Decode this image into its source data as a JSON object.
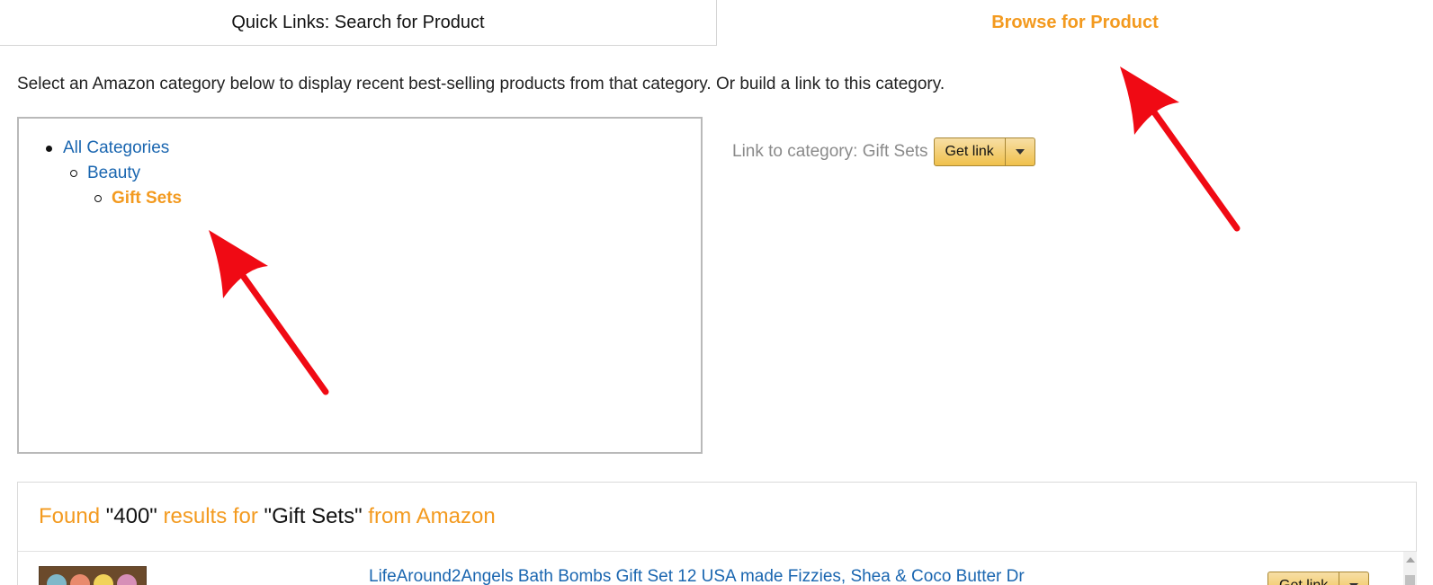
{
  "tabs": {
    "quick_links": "Quick Links: Search for Product",
    "browse": "Browse for Product"
  },
  "instructions": "Select an Amazon category below to display recent best-selling products from that category. Or build a link to this category.",
  "category_tree": {
    "root": "All Categories",
    "level1": "Beauty",
    "level2": "Gift Sets"
  },
  "link_to_category": {
    "label": "Link to category: Gift Sets",
    "button": "Get link"
  },
  "results": {
    "found_word": "Found",
    "count": "\"400\"",
    "results_for": "results for",
    "query": "\"Gift Sets\"",
    "from_amazon": "from Amazon"
  },
  "result_rows": [
    {
      "title": "LifeAround2Angels Bath Bombs Gift Set 12 USA made Fizzies, Shea & Coco Butter Dr",
      "button": "Get link"
    }
  ],
  "colors": {
    "accent_orange": "#f39a1f",
    "link_blue": "#1a66b0",
    "annotation_red": "#f00a14"
  },
  "icons": {
    "dropdown": "chevron-down-icon",
    "annotation": "red-arrow-icon"
  }
}
